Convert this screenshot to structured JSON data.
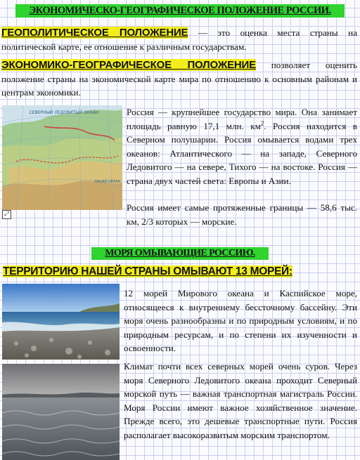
{
  "header": {
    "title": "ЭКОНОМИЧЕСКО-ГЕОГРАФИЧЕСКОЕ ПОЛОЖЕНИЕ РОССИИ."
  },
  "definitions": {
    "geopolitical_term": "ГЕОПОЛИТИЧЕСКОЕ ПОЛОЖЕНИЕ",
    "geopolitical_text": " — это оценка места страны на политической карте, ее отношение к различным государствам.",
    "economic_term": "ЭКОНОМИКО-ГЕОГРАФИЧЕСКОЕ ПОЛОЖЕНИЕ",
    "economic_text": " позволяет оценить положение страны на экономической карте мира по отношению к основным районам и центрам экономики."
  },
  "russia": {
    "map_labels": [
      "СЕВЕРНЫЙ ЛЕДОВИТЫЙ ОКЕАН",
      "ТИХИЙ ОКЕАН"
    ],
    "text_part1": "Россия — крупнейшее государство мира. Она занимает площадь равную 17,1 млн. км",
    "area_sup": "2",
    "text_part2": ". Россия находится в Северном полушарии. Россия омывается водами трех океанов: Атлантического — на западе, Северного Ледовитого — на севере, Тихого — на востоке. Россия — страна двух частей света: Европы и Азии.",
    "border_text": "Россия имеет самые протяженные границы — 58,6 тыс. км, 2/3 которых — морские."
  },
  "seas": {
    "section_title": "МОРЯ ОМЫВАЮЩИЕ РОССИЮ.",
    "subtitle": "ТЕРРИТОРИЮ НАШЕЙ СТРАНЫ ОМЫВАЮТ 13 МОРЕЙ",
    "subtitle_suffix": ":",
    "paragraph1": "12 морей Мирового океана и Каспийское море, относящееся к внутреннему бессточному бассейну. Эти моря очень разнообразны и по природным условиям, и по природным ресурсам, и по степени их изученности и освоенности.",
    "paragraph2": "Климат почти всех северных морей очень суров. Через моря Северного Ледовитого океана проходит Северный морской путь — важная транспортная магистраль России. Моря России имеют важное хозяйственное значение. Прежде всего, это дешевые транспортные пути. Россия располагает высокоразвитым морским транспортом."
  },
  "colors": {
    "title_highlight": "#2fd42f",
    "term_highlight": "#f2ee1a",
    "grid_line": "#c9cfee"
  }
}
